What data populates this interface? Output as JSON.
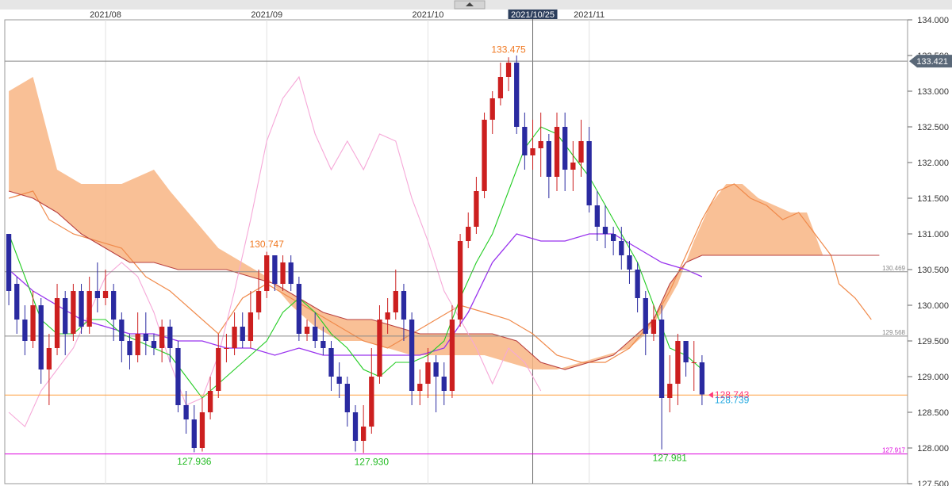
{
  "chart_data": {
    "type": "candlestick",
    "ylim": [
      127.5,
      134.0
    ],
    "x_count": 112,
    "grid": true,
    "timeline": {
      "months": [
        {
          "label": "2021/08",
          "index": 12
        },
        {
          "label": "2021/09",
          "index": 32
        },
        {
          "label": "2021/10",
          "index": 52
        },
        {
          "label": "2021/11",
          "index": 72
        }
      ],
      "cursor": {
        "label": "2021/10/25",
        "index": 65
      }
    },
    "y_ticks": [
      "127.500",
      "128.000",
      "128.500",
      "129.000",
      "129.500",
      "130.000",
      "130.500",
      "131.000",
      "131.500",
      "132.000",
      "132.500",
      "133.000",
      "133.500",
      "134.000"
    ],
    "price_tag": "133.421",
    "horizontal_lines": [
      {
        "value": 133.421,
        "label": "",
        "color": "#888888"
      },
      {
        "value": 130.469,
        "label": "130.469",
        "color": "#888888"
      },
      {
        "value": 129.568,
        "label": "129.568",
        "color": "#888888"
      },
      {
        "value": 128.741,
        "label": "",
        "color": "#ffa040"
      },
      {
        "value": 127.917,
        "label": "127.917",
        "color": "#dd00dd"
      }
    ],
    "annotations": [
      {
        "text": "133.475",
        "index": 62,
        "value": 133.475,
        "color": "#f07820",
        "pos": "above"
      },
      {
        "text": "130.747",
        "index": 32,
        "value": 130.747,
        "color": "#f07820",
        "pos": "above"
      },
      {
        "text": "127.936",
        "index": 23,
        "value": 127.936,
        "color": "#22bb22",
        "pos": "below"
      },
      {
        "text": "127.930",
        "index": 45,
        "value": 127.93,
        "color": "#22bb22",
        "pos": "below"
      },
      {
        "text": "127.981",
        "index": 82,
        "value": 127.981,
        "color": "#22bb22",
        "pos": "below"
      }
    ],
    "last_values": [
      {
        "text": "128.743",
        "value": 128.743,
        "color": "#ff3a7a"
      },
      {
        "text": "128.739",
        "value": 128.739,
        "color": "#22a8e0"
      }
    ],
    "candles": [
      [
        131.0,
        130.2,
        130.8,
        130.0
      ],
      [
        130.3,
        129.8,
        130.4,
        129.6
      ],
      [
        129.8,
        129.5,
        130.0,
        129.3
      ],
      [
        129.5,
        130.0,
        130.2,
        129.4
      ],
      [
        130.0,
        129.1,
        130.1,
        128.9
      ],
      [
        129.1,
        129.4,
        129.6,
        128.6
      ],
      [
        129.4,
        130.1,
        130.3,
        129.3
      ],
      [
        130.1,
        129.6,
        130.2,
        129.3
      ],
      [
        129.6,
        130.2,
        130.3,
        129.5
      ],
      [
        130.2,
        129.7,
        130.3,
        129.6
      ],
      [
        129.7,
        130.2,
        130.4,
        129.6
      ],
      [
        130.2,
        130.1,
        130.6,
        129.9
      ],
      [
        130.1,
        130.2,
        130.5,
        130.0
      ],
      [
        130.2,
        129.8,
        130.3,
        129.5
      ],
      [
        129.8,
        129.5,
        129.9,
        129.2
      ],
      [
        129.5,
        129.3,
        129.6,
        129.1
      ],
      [
        129.3,
        129.6,
        129.9,
        129.2
      ],
      [
        129.6,
        129.5,
        129.9,
        129.3
      ],
      [
        129.5,
        129.4,
        129.6,
        129.3
      ],
      [
        129.4,
        129.7,
        129.8,
        129.2
      ],
      [
        129.7,
        129.4,
        129.8,
        129.2
      ],
      [
        129.4,
        128.6,
        129.5,
        128.5
      ],
      [
        128.6,
        128.4,
        128.8,
        128.2
      ],
      [
        128.4,
        128.0,
        128.6,
        127.94
      ],
      [
        128.0,
        128.5,
        128.7,
        127.95
      ],
      [
        128.5,
        128.8,
        129.0,
        128.4
      ],
      [
        128.8,
        129.4,
        129.6,
        128.7
      ],
      [
        129.4,
        129.4,
        129.6,
        129.2
      ],
      [
        129.4,
        129.7,
        129.9,
        129.3
      ],
      [
        129.7,
        129.5,
        129.9,
        129.4
      ],
      [
        129.5,
        129.9,
        130.2,
        129.4
      ],
      [
        129.9,
        130.2,
        130.5,
        129.8
      ],
      [
        130.2,
        130.7,
        130.75,
        130.1
      ],
      [
        130.7,
        130.3,
        130.7,
        130.2
      ],
      [
        130.3,
        130.6,
        130.7,
        130.2
      ],
      [
        130.6,
        130.3,
        130.7,
        130.2
      ],
      [
        130.3,
        129.6,
        130.4,
        129.5
      ],
      [
        129.6,
        129.7,
        129.8,
        129.5
      ],
      [
        129.7,
        129.5,
        129.9,
        129.4
      ],
      [
        129.5,
        129.4,
        129.7,
        129.3
      ],
      [
        129.4,
        129.0,
        129.5,
        128.8
      ],
      [
        129.0,
        128.9,
        129.2,
        128.7
      ],
      [
        128.9,
        128.5,
        129.0,
        128.3
      ],
      [
        128.5,
        128.1,
        128.6,
        127.95
      ],
      [
        128.1,
        128.3,
        128.6,
        127.93
      ],
      [
        128.3,
        129.0,
        129.4,
        128.2
      ],
      [
        129.0,
        129.8,
        130.0,
        128.9
      ],
      [
        129.8,
        129.9,
        130.1,
        129.6
      ],
      [
        129.9,
        130.2,
        130.5,
        129.8
      ],
      [
        130.2,
        129.8,
        130.3,
        129.5
      ],
      [
        129.8,
        128.8,
        129.9,
        128.6
      ],
      [
        128.8,
        128.9,
        129.1,
        128.6
      ],
      [
        128.9,
        129.2,
        129.4,
        128.7
      ],
      [
        129.2,
        129.0,
        129.3,
        128.5
      ],
      [
        129.0,
        128.8,
        129.2,
        128.6
      ],
      [
        128.8,
        129.8,
        130.0,
        128.7
      ],
      [
        129.8,
        130.9,
        131.0,
        129.7
      ],
      [
        130.9,
        131.1,
        131.3,
        130.8
      ],
      [
        131.1,
        131.6,
        131.8,
        131.0
      ],
      [
        131.6,
        132.6,
        132.7,
        131.5
      ],
      [
        132.6,
        132.9,
        133.0,
        132.4
      ],
      [
        132.9,
        133.2,
        133.4,
        132.8
      ],
      [
        133.2,
        133.4,
        133.475,
        133.0
      ],
      [
        133.4,
        132.5,
        133.5,
        132.4
      ],
      [
        132.5,
        132.1,
        132.7,
        131.9
      ],
      [
        132.1,
        132.2,
        132.6,
        131.9
      ],
      [
        132.2,
        132.3,
        132.7,
        131.8
      ],
      [
        132.3,
        131.8,
        132.4,
        131.5
      ],
      [
        131.8,
        132.5,
        132.7,
        131.6
      ],
      [
        132.5,
        131.9,
        132.7,
        131.6
      ],
      [
        131.9,
        132.0,
        132.3,
        131.6
      ],
      [
        132.0,
        132.3,
        132.6,
        131.8
      ],
      [
        132.3,
        131.4,
        132.5,
        131.3
      ],
      [
        131.4,
        131.1,
        131.6,
        130.9
      ],
      [
        131.1,
        131.0,
        131.4,
        130.8
      ],
      [
        131.0,
        130.9,
        131.1,
        130.7
      ],
      [
        130.9,
        130.7,
        131.1,
        130.5
      ],
      [
        130.7,
        130.5,
        130.9,
        130.3
      ],
      [
        130.5,
        130.1,
        130.6,
        129.9
      ],
      [
        130.1,
        129.6,
        130.2,
        129.3
      ],
      [
        129.6,
        129.8,
        130.0,
        129.5
      ],
      [
        129.8,
        128.7,
        130.0,
        127.98
      ],
      [
        128.7,
        128.9,
        129.3,
        128.5
      ],
      [
        128.9,
        129.5,
        129.6,
        128.6
      ],
      [
        129.5,
        129.2,
        129.5,
        129.0
      ],
      [
        129.2,
        129.2,
        129.5,
        128.8
      ],
      [
        129.2,
        128.75,
        129.3,
        128.6
      ]
    ],
    "cloud_span_a": [
      [
        0,
        131.5
      ],
      [
        3,
        131.6
      ],
      [
        5,
        131.2
      ],
      [
        8,
        131.0
      ],
      [
        11,
        130.9
      ],
      [
        14,
        130.8
      ],
      [
        17,
        130.4
      ],
      [
        20,
        130.2
      ],
      [
        23,
        129.9
      ],
      [
        26,
        129.6
      ],
      [
        29,
        130.1
      ],
      [
        32,
        130.3
      ],
      [
        35,
        130.1
      ],
      [
        38,
        129.9
      ],
      [
        41,
        129.7
      ],
      [
        44,
        129.5
      ],
      [
        47,
        129.4
      ],
      [
        50,
        129.6
      ],
      [
        53,
        129.8
      ],
      [
        56,
        130.0
      ],
      [
        59,
        129.9
      ],
      [
        62,
        129.8
      ],
      [
        65,
        129.6
      ],
      [
        68,
        129.3
      ],
      [
        71,
        129.2
      ],
      [
        74,
        129.2
      ],
      [
        77,
        129.4
      ],
      [
        80,
        129.8
      ],
      [
        82,
        130.2
      ],
      [
        84,
        130.7
      ],
      [
        86,
        131.2
      ],
      [
        88,
        131.6
      ],
      [
        90,
        131.7
      ],
      [
        92,
        131.5
      ],
      [
        94,
        131.4
      ],
      [
        96,
        131.2
      ],
      [
        98,
        131.3
      ],
      [
        100,
        131.0
      ],
      [
        102,
        130.7
      ],
      [
        103,
        130.3
      ],
      [
        105,
        130.1
      ],
      [
        107,
        129.8
      ]
    ],
    "cloud_span_b": [
      [
        0,
        131.6
      ],
      [
        3,
        131.5
      ],
      [
        6,
        131.3
      ],
      [
        9,
        131.0
      ],
      [
        12,
        130.8
      ],
      [
        15,
        130.6
      ],
      [
        18,
        130.6
      ],
      [
        21,
        130.5
      ],
      [
        24,
        130.5
      ],
      [
        27,
        130.5
      ],
      [
        30,
        130.4
      ],
      [
        33,
        130.3
      ],
      [
        36,
        130.1
      ],
      [
        39,
        129.9
      ],
      [
        42,
        129.8
      ],
      [
        45,
        129.8
      ],
      [
        48,
        129.7
      ],
      [
        51,
        129.6
      ],
      [
        54,
        129.6
      ],
      [
        57,
        129.6
      ],
      [
        60,
        129.6
      ],
      [
        63,
        129.5
      ],
      [
        66,
        129.2
      ],
      [
        69,
        129.1
      ],
      [
        72,
        129.2
      ],
      [
        75,
        129.3
      ],
      [
        78,
        129.6
      ],
      [
        80,
        129.8
      ],
      [
        82,
        130.3
      ],
      [
        84,
        130.6
      ],
      [
        86,
        130.7
      ],
      [
        90,
        130.7
      ],
      [
        95,
        130.7
      ],
      [
        100,
        130.7
      ],
      [
        105,
        130.7
      ],
      [
        108,
        130.7
      ]
    ],
    "cloud_fill_region": [
      [
        0,
        133.0
      ],
      [
        3,
        133.2
      ],
      [
        6,
        131.9
      ],
      [
        9,
        131.7
      ],
      [
        12,
        131.7
      ],
      [
        14,
        131.7
      ],
      [
        16,
        131.8
      ],
      [
        18,
        131.9
      ],
      [
        20,
        131.6
      ],
      [
        23,
        131.2
      ],
      [
        26,
        130.8
      ],
      [
        29,
        130.6
      ],
      [
        32,
        130.4
      ],
      [
        35,
        130.0
      ],
      [
        38,
        129.7
      ],
      [
        41,
        129.5
      ],
      [
        44,
        129.5
      ],
      [
        47,
        129.4
      ],
      [
        50,
        129.3
      ],
      [
        53,
        129.3
      ],
      [
        56,
        129.3
      ],
      [
        59,
        129.3
      ],
      [
        62,
        129.2
      ],
      [
        65,
        129.1
      ],
      [
        68,
        129.1
      ],
      [
        71,
        129.2
      ],
      [
        74,
        129.3
      ],
      [
        77,
        129.4
      ],
      [
        79,
        129.6
      ],
      [
        81,
        129.9
      ],
      [
        83,
        130.3
      ],
      [
        85,
        130.9
      ],
      [
        87,
        131.4
      ],
      [
        89,
        131.7
      ],
      [
        91,
        131.7
      ],
      [
        93,
        131.5
      ],
      [
        95,
        131.4
      ],
      [
        97,
        131.3
      ],
      [
        99,
        131.3
      ],
      [
        101,
        130.7
      ],
      [
        102,
        130.7
      ]
    ],
    "base_line": [
      [
        0,
        130.5
      ],
      [
        3,
        130.2
      ],
      [
        6,
        130.0
      ],
      [
        9,
        129.8
      ],
      [
        12,
        129.7
      ],
      [
        15,
        129.6
      ],
      [
        18,
        129.6
      ],
      [
        21,
        129.5
      ],
      [
        24,
        129.5
      ],
      [
        27,
        129.4
      ],
      [
        30,
        129.4
      ],
      [
        33,
        129.3
      ],
      [
        36,
        129.4
      ],
      [
        39,
        129.3
      ],
      [
        42,
        129.3
      ],
      [
        45,
        129.3
      ],
      [
        48,
        129.3
      ],
      [
        51,
        129.3
      ],
      [
        54,
        129.4
      ],
      [
        57,
        129.9
      ],
      [
        60,
        130.6
      ],
      [
        63,
        131.0
      ],
      [
        66,
        130.9
      ],
      [
        69,
        130.9
      ],
      [
        72,
        131.0
      ],
      [
        75,
        131.0
      ],
      [
        78,
        130.8
      ],
      [
        81,
        130.6
      ],
      [
        84,
        130.5
      ],
      [
        86,
        130.4
      ]
    ],
    "conversion_line": [
      [
        0,
        131.0
      ],
      [
        2,
        130.4
      ],
      [
        4,
        129.8
      ],
      [
        6,
        129.6
      ],
      [
        8,
        129.6
      ],
      [
        10,
        129.8
      ],
      [
        12,
        129.8
      ],
      [
        14,
        129.6
      ],
      [
        16,
        129.5
      ],
      [
        18,
        129.4
      ],
      [
        20,
        129.3
      ],
      [
        22,
        129.0
      ],
      [
        24,
        128.7
      ],
      [
        26,
        128.9
      ],
      [
        28,
        129.1
      ],
      [
        30,
        129.3
      ],
      [
        32,
        129.5
      ],
      [
        34,
        129.9
      ],
      [
        36,
        130.1
      ],
      [
        38,
        129.9
      ],
      [
        40,
        129.6
      ],
      [
        42,
        129.4
      ],
      [
        44,
        129.1
      ],
      [
        46,
        129.0
      ],
      [
        48,
        129.2
      ],
      [
        50,
        129.2
      ],
      [
        52,
        129.3
      ],
      [
        54,
        129.5
      ],
      [
        56,
        130.1
      ],
      [
        58,
        130.6
      ],
      [
        60,
        131.0
      ],
      [
        62,
        131.6
      ],
      [
        64,
        132.2
      ],
      [
        66,
        132.5
      ],
      [
        68,
        132.4
      ],
      [
        70,
        132.1
      ],
      [
        72,
        131.8
      ],
      [
        74,
        131.4
      ],
      [
        76,
        131.0
      ],
      [
        78,
        130.6
      ],
      [
        80,
        130.0
      ],
      [
        82,
        129.4
      ],
      [
        84,
        129.3
      ],
      [
        86,
        129.1
      ]
    ],
    "lagging_line": [
      [
        0,
        128.5
      ],
      [
        2,
        128.3
      ],
      [
        4,
        128.8
      ],
      [
        6,
        129.1
      ],
      [
        8,
        129.4
      ],
      [
        10,
        129.9
      ],
      [
        12,
        130.4
      ],
      [
        14,
        130.6
      ],
      [
        16,
        130.4
      ],
      [
        18,
        129.9
      ],
      [
        20,
        129.2
      ],
      [
        22,
        128.6
      ],
      [
        24,
        128.7
      ],
      [
        26,
        129.3
      ],
      [
        28,
        130.2
      ],
      [
        30,
        131.2
      ],
      [
        32,
        132.3
      ],
      [
        34,
        132.9
      ],
      [
        36,
        133.2
      ],
      [
        38,
        132.4
      ],
      [
        40,
        131.9
      ],
      [
        42,
        132.3
      ],
      [
        44,
        131.9
      ],
      [
        46,
        132.4
      ],
      [
        48,
        132.3
      ],
      [
        50,
        131.5
      ],
      [
        52,
        130.9
      ],
      [
        54,
        130.2
      ],
      [
        56,
        129.8
      ],
      [
        58,
        129.4
      ],
      [
        60,
        128.9
      ],
      [
        62,
        129.4
      ],
      [
        64,
        129.2
      ],
      [
        66,
        128.8
      ]
    ]
  }
}
